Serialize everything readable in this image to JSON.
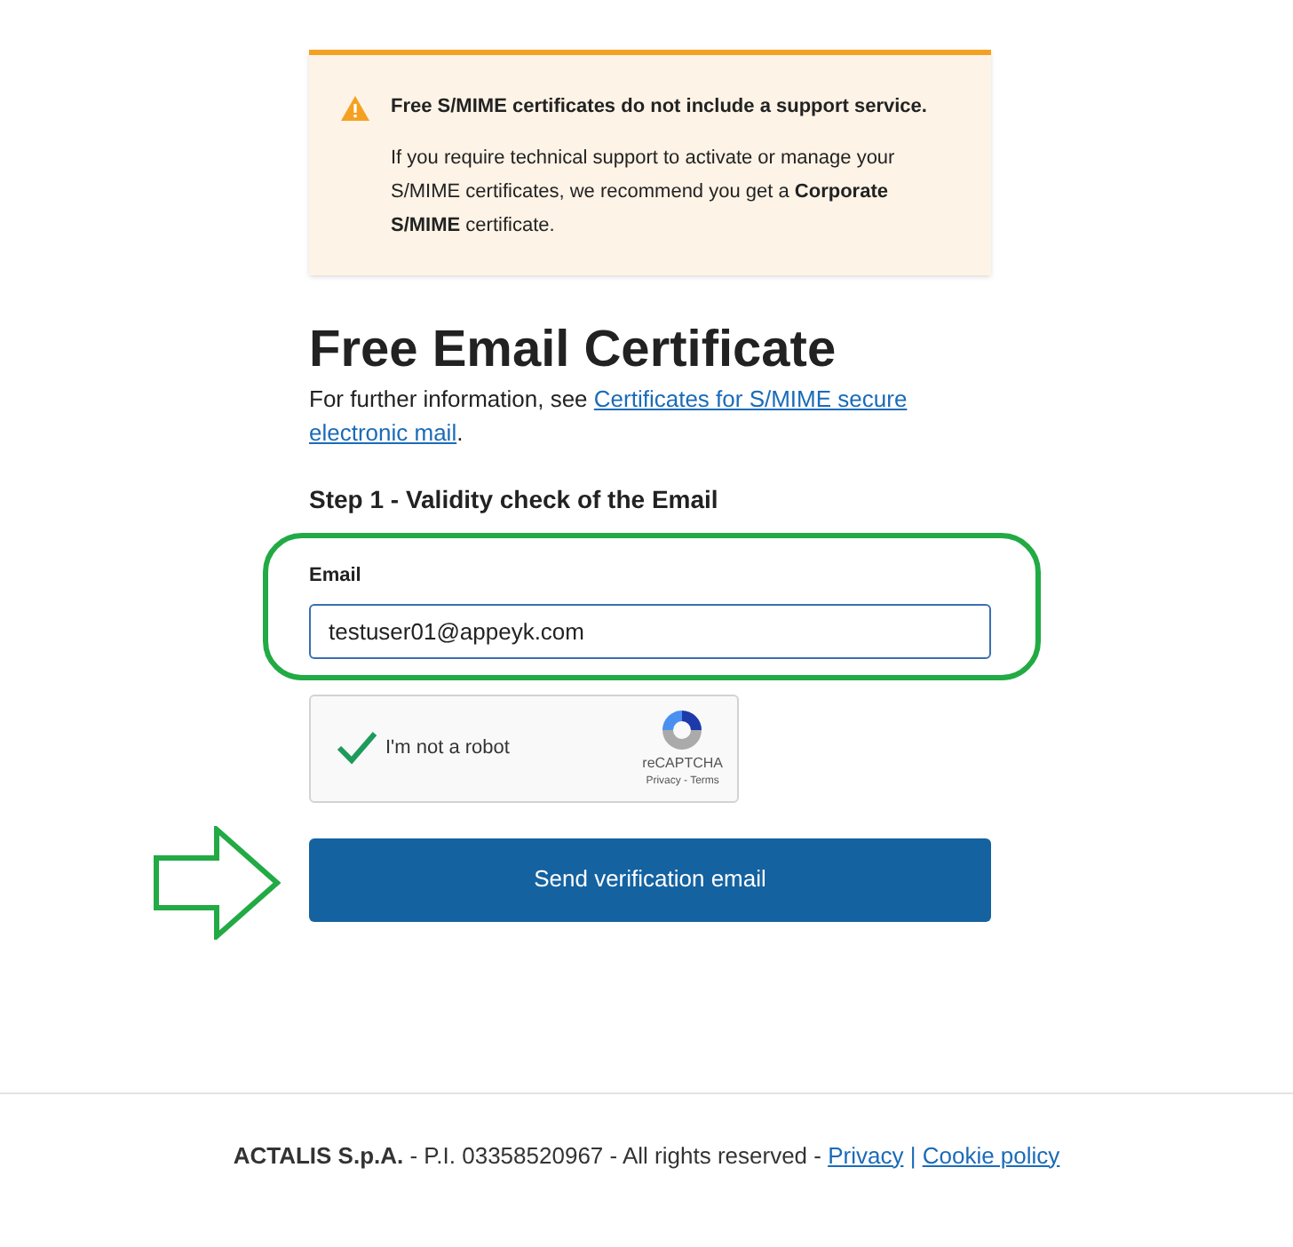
{
  "notice": {
    "title": "Free S/MIME certificates do not include a support service.",
    "body": "If you require technical support to activate or manage your S/MIME certificates, we recommend you get a **Corporate S/MIME** certificate."
  },
  "heading": "Free Email Certificate",
  "intro": {
    "text": "For further information, see ",
    "link": [
      "Certificates for S/MIME secure",
      "electronic mail"
    ],
    "end": "."
  },
  "step": "Step 1 - Validity check of the Email",
  "email": {
    "label": "Email",
    "value": "testuser01@appeyk.com",
    "highlighted": true
  },
  "captcha": {
    "label": "I'm not a robot",
    "checked": true,
    "brand": "reCAPTCHA",
    "links": "Privacy - Terms"
  },
  "submit": {
    "label": "Send verification email",
    "pointed": true
  },
  "footer": {
    "company": "ACTALIS S.p.A.",
    "info": " - P.I. 03358520967 - All rights reserved - ",
    "links": [
      "Privacy",
      "Cookie policy"
    ],
    "separator": "|"
  }
}
